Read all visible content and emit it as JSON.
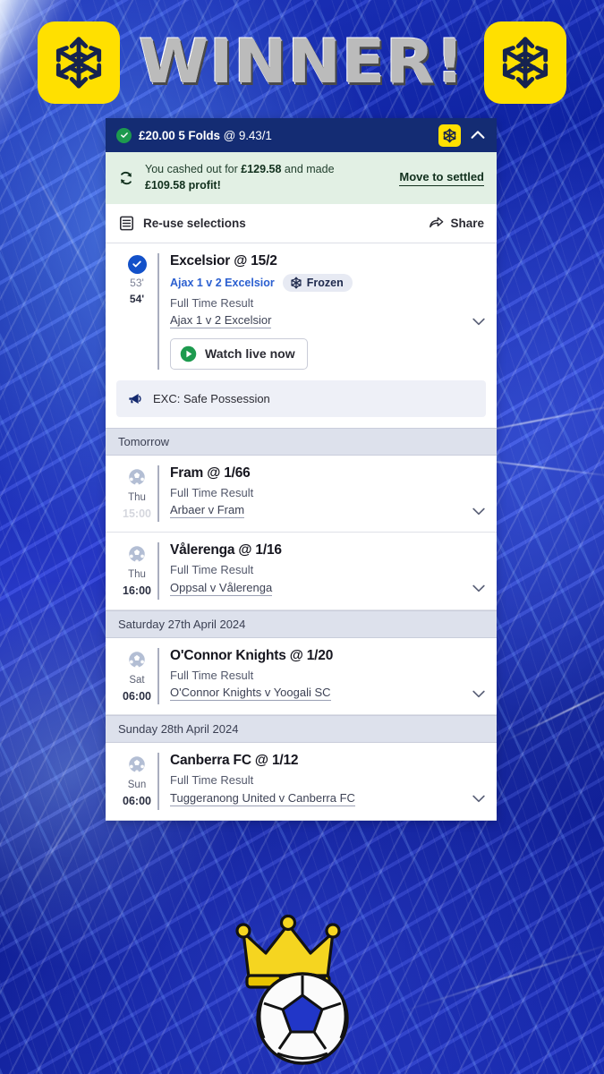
{
  "banner": {
    "title": "WINNER!",
    "left_badge_icon": "snowflake-icon",
    "right_badge_icon": "snowflake-icon",
    "badge_color": "#ffe000",
    "title_color": "#c9c9c9"
  },
  "bet_header": {
    "status_icon": "check-circle-icon",
    "stake": "£20.00",
    "folds": "5 Folds",
    "odds": "@ 9.43/1",
    "badge_icon": "snowflake-icon",
    "collapse_icon": "chevron-up-icon",
    "bg_color": "#142c73"
  },
  "cashout": {
    "icon": "cashout-refresh-icon",
    "text_prefix": "You cashed out for ",
    "amount": "£129.58",
    "text_middle": " and made ",
    "profit": "£109.58 profit!",
    "action_label": "Move to settled",
    "bg_color": "#e2f0e4"
  },
  "toolbar": {
    "reuse_icon": "list-document-icon",
    "reuse_label": "Re-use selections",
    "share_icon": "share-arrow-icon",
    "share_label": "Share"
  },
  "live_selection": {
    "status_icon": "check-circle-filled-icon",
    "minute_1": "53'",
    "minute_2": "54'",
    "title": "Excelsior @ 15/2",
    "fixture_link": "Ajax 1 v 2 Excelsior",
    "frozen_icon": "snowflake-icon",
    "frozen_label": "Frozen",
    "market": "Full Time Result",
    "fixture": "Ajax 1 v 2 Excelsior",
    "expand_icon": "chevron-down-icon",
    "watch_icon": "play-circle-icon",
    "watch_label": "Watch live now"
  },
  "exc_banner": {
    "icon": "megaphone-icon",
    "text": "EXC: Safe Possession"
  },
  "groups": [
    {
      "date_label": "Tomorrow",
      "rows": [
        {
          "icon": "football-icon",
          "day": "Thu",
          "time": "15:00",
          "time_faded": true,
          "title": "Fram @ 1/66",
          "market": "Full Time Result",
          "fixture": "Arbaer v Fram",
          "expand_icon": "chevron-down-icon"
        },
        {
          "icon": "football-icon",
          "day": "Thu",
          "time": "16:00",
          "time_faded": false,
          "title": "Vålerenga @ 1/16",
          "market": "Full Time Result",
          "fixture": "Oppsal v Vålerenga",
          "expand_icon": "chevron-down-icon"
        }
      ]
    },
    {
      "date_label": "Saturday 27th April 2024",
      "rows": [
        {
          "icon": "football-icon",
          "day": "Sat",
          "time": "06:00",
          "time_faded": false,
          "title": "O'Connor Knights @ 1/20",
          "market": "Full Time Result",
          "fixture": "O'Connor Knights v Yoogali SC",
          "expand_icon": "chevron-down-icon"
        }
      ]
    },
    {
      "date_label": "Sunday 28th April 2024",
      "rows": [
        {
          "icon": "football-icon",
          "day": "Sun",
          "time": "06:00",
          "time_faded": false,
          "title": "Canberra FC @ 1/12",
          "market": "Full Time Result",
          "fixture": "Tuggeranong United v Canberra FC",
          "expand_icon": "chevron-down-icon"
        }
      ]
    }
  ],
  "footer_emoji": {
    "crown_icon": "crown-icon",
    "ball_icon": "soccer-ball-icon"
  }
}
